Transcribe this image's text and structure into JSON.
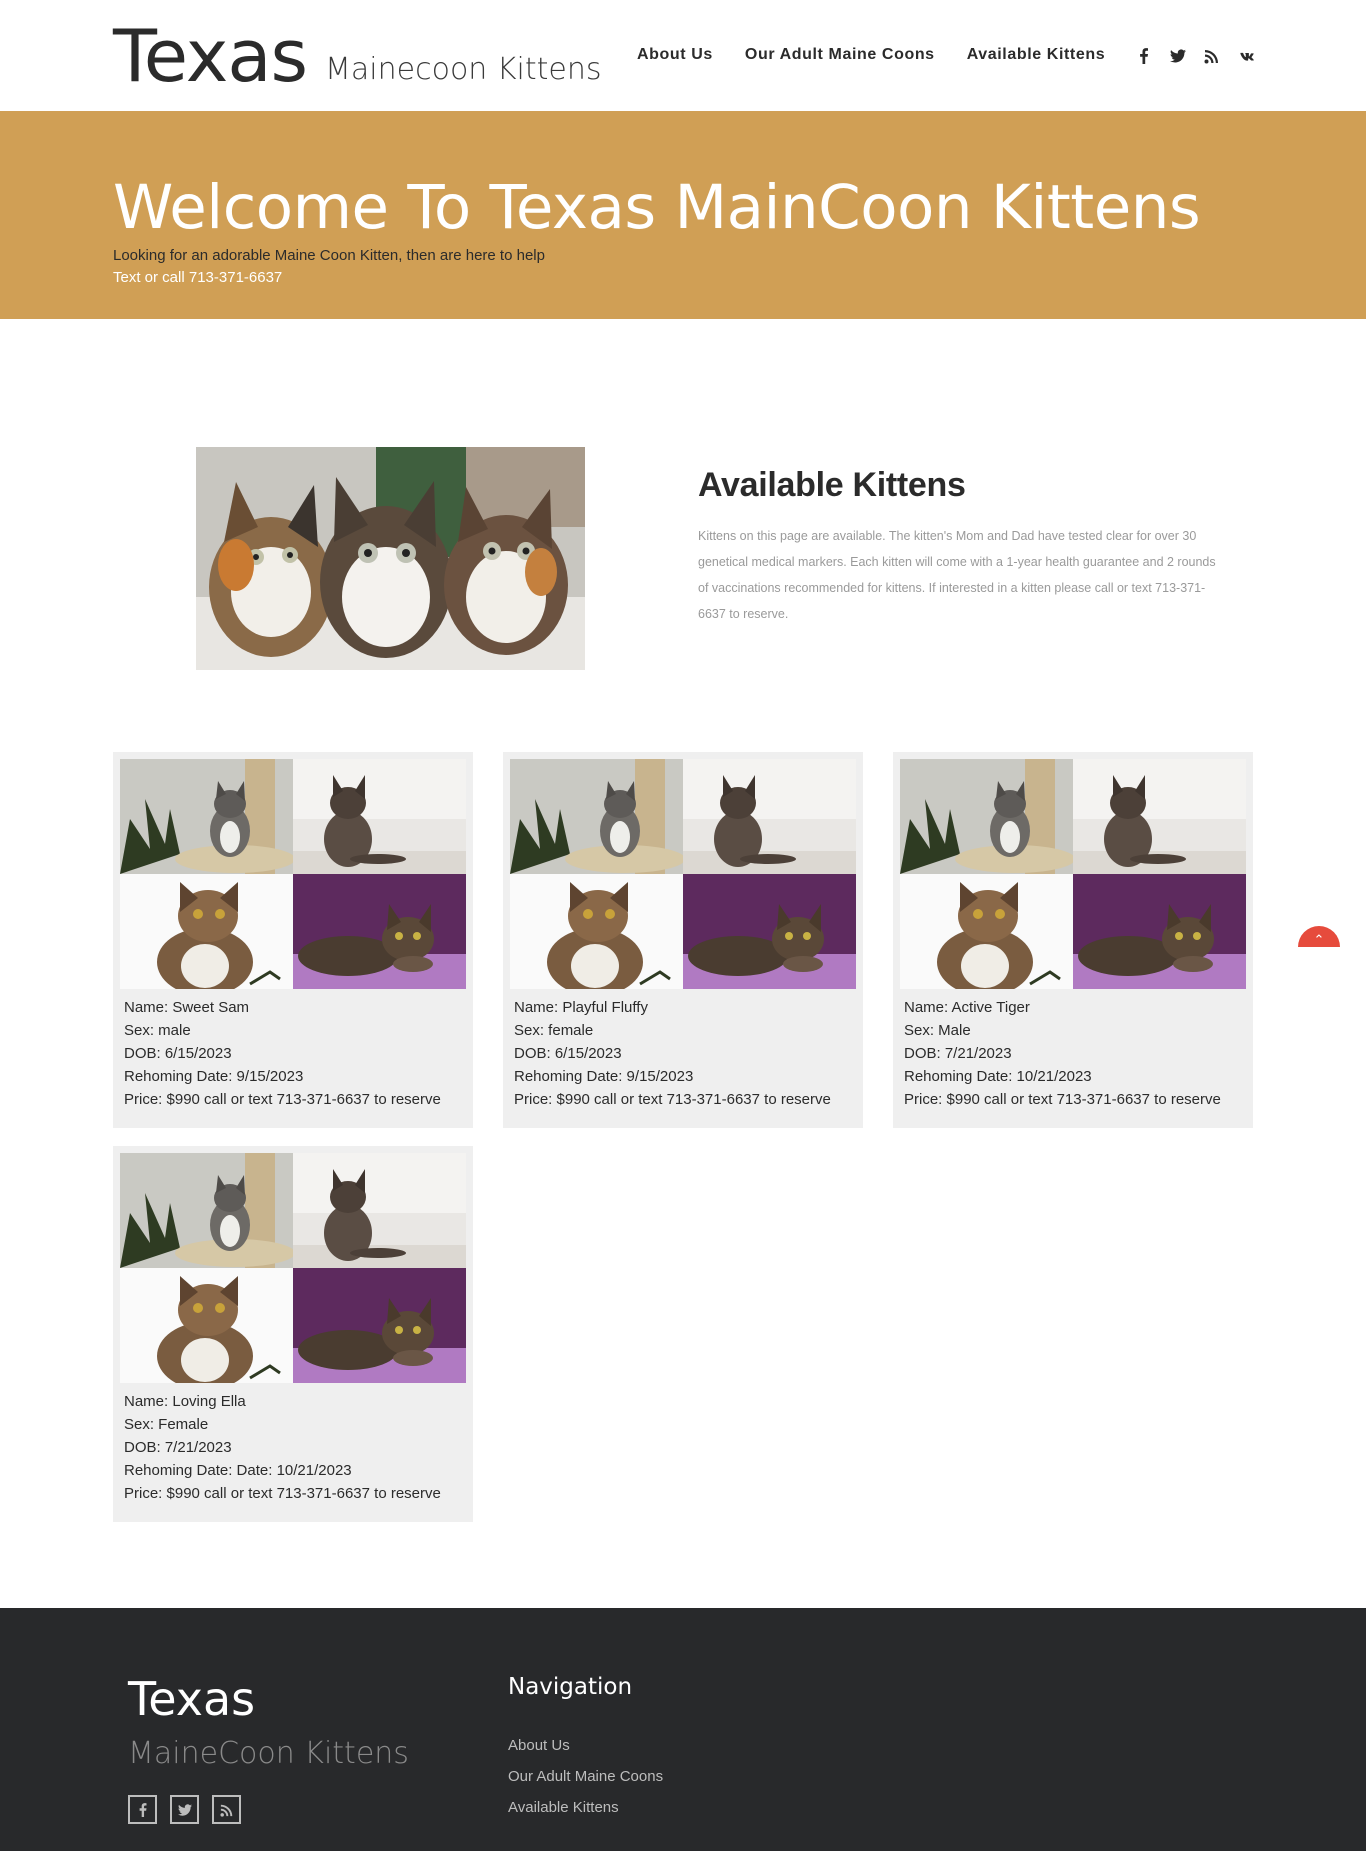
{
  "header": {
    "logo_main": "Texas",
    "logo_sub": "Mainecoon Kittens",
    "nav": [
      "About Us",
      "Our Adult Maine Coons",
      "Available Kittens"
    ],
    "social_icons": [
      "facebook-icon",
      "twitter-icon",
      "rss-icon",
      "vk-icon"
    ]
  },
  "hero": {
    "title": "Welcome To Texas MainCoon Kittens",
    "line1": "Looking for an adorable Maine Coon Kitten, then are here to help",
    "line2": "Text or call 713-371-6637",
    "background_color": "#d09f55"
  },
  "intro": {
    "title": "Available Kittens",
    "text": "Kittens on this page are available. The kitten's Mom and Dad have tested clear for over 30 genetical medical markers. Each kitten will come with a 1-year health guarantee and 2 rounds of vaccinations recommended for kittens. If interested in a kitten please call or text 713-371-6637 to reserve."
  },
  "kittens": [
    {
      "name": "Name: Sweet Sam",
      "sex": "Sex: male",
      "dob": "DOB: 6/15/2023",
      "rehoming": "Rehoming Date: 9/15/2023",
      "price": "Price: $990 call or text 713-371-6637 to reserve"
    },
    {
      "name": "Name: Playful Fluffy",
      "sex": "Sex: female",
      "dob": "DOB: 6/15/2023",
      "rehoming": "Rehoming Date: 9/15/2023",
      "price": "Price: $990 call or text 713-371-6637 to reserve"
    },
    {
      "name": "Name: Active Tiger",
      "sex": "Sex: Male",
      "dob": "DOB: 7/21/2023",
      "rehoming": "Rehoming Date: 10/21/2023",
      "price": "Price: $990 call or text 713-371-6637 to reserve"
    },
    {
      "name": "Name: Loving Ella",
      "sex": "Sex: Female",
      "dob": "DOB: 7/21/2023",
      "rehoming": "Rehoming Date: Date: 10/21/2023",
      "price": "Price: $990 call or text 713-371-6637 to reserve"
    }
  ],
  "scroll_top": {
    "icon": "chevron-up-icon",
    "color": "#e64b3c"
  },
  "footer": {
    "logo_main": "Texas",
    "logo_sub": "MaineCoon Kittens",
    "nav_title": "Navigation",
    "nav": [
      "About Us",
      "Our Adult Maine Coons",
      "Available Kittens"
    ],
    "social_icons": [
      "facebook-icon",
      "twitter-icon",
      "rss-icon"
    ],
    "background_color": "#28292b"
  }
}
